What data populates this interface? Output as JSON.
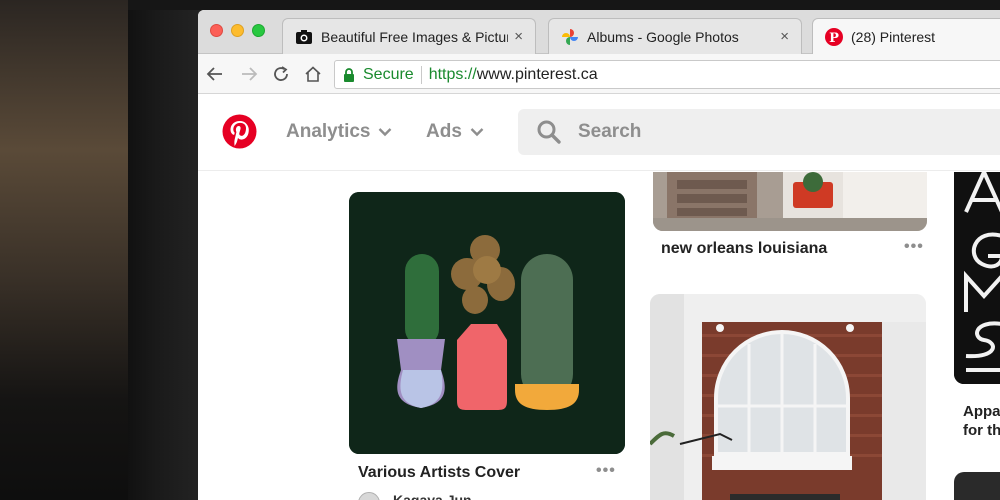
{
  "browser": {
    "tabs": [
      {
        "title": "Beautiful Free Images & Pictures",
        "icon": "camera-icon",
        "close": "×"
      },
      {
        "title": "Albums - Google Photos",
        "icon": "google-photos-icon",
        "close": "×"
      },
      {
        "title": "(28) Pinterest",
        "icon": "pinterest-icon"
      }
    ],
    "omnibox": {
      "secure_label": "Secure",
      "url_scheme": "https://",
      "url_host": "www.pinterest.ca"
    }
  },
  "header": {
    "nav": [
      {
        "label": "Analytics"
      },
      {
        "label": "Ads"
      }
    ],
    "search_placeholder": "Search"
  },
  "feed": {
    "pins": [
      {
        "title": "Various Artists Cover",
        "author": "Kagaya Jun",
        "more": "•••"
      },
      {
        "title": "new orleans louisiana",
        "more": "•••"
      },
      {
        "title": "Appa\nfor th"
      }
    ]
  },
  "colors": {
    "pinterest_red": "#e60023",
    "secure_green": "#1a8a2e",
    "cactus_bg": "#0f2619"
  }
}
